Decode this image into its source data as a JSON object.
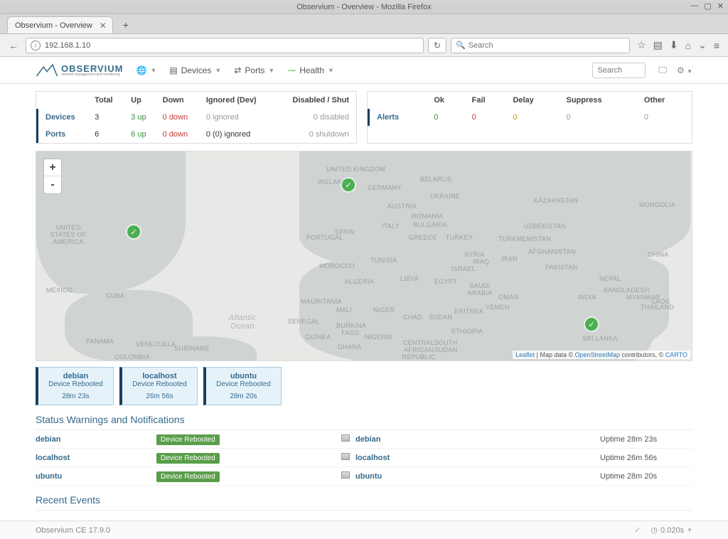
{
  "browser": {
    "window_title": "Observium - Overview - Mozilla Firefox",
    "tab_title": "Observium - Overview",
    "url": "192.168.1.10",
    "search_placeholder": "Search"
  },
  "nav": {
    "logo_main": "OBSERVIUM",
    "logo_sub": "network management and monitoring",
    "items": [
      {
        "label": "Devices"
      },
      {
        "label": "Ports"
      },
      {
        "label": "Health"
      }
    ],
    "search_placeholder": "Search"
  },
  "summary": {
    "headers": [
      "",
      "Total",
      "Up",
      "Down",
      "Ignored (Dev)",
      "Disabled / Shut"
    ],
    "rows": [
      {
        "label": "Devices",
        "total": "3",
        "up": "3 up",
        "down": "0 down",
        "ignored": "0 ignored",
        "disabled": "0 disabled"
      },
      {
        "label": "Ports",
        "total": "6",
        "up": "6 up",
        "down": "0 down",
        "ignored": "0 (0) ignored",
        "disabled": "0 shutdown"
      }
    ]
  },
  "alerts": {
    "headers": [
      "",
      "Ok",
      "Fail",
      "Delay",
      "Suppress",
      "Other"
    ],
    "row": {
      "label": "Alerts",
      "ok": "0",
      "fail": "0",
      "delay": "0",
      "suppress": "0",
      "other": "0"
    }
  },
  "map": {
    "zoom_in": "+",
    "zoom_out": "-",
    "labels": [
      "UNITED KINGDOM",
      "IRELAND",
      "GERMANY",
      "BELARUS",
      "UKRAINE",
      "AUSTRIA",
      "ROMANIA",
      "BULGARIA",
      "ITALY",
      "SPAIN",
      "PORTUGAL",
      "GREECE",
      "TURKEY",
      "KAZAKHSTAN",
      "UZBEKISTAN",
      "TURKMENISTAN",
      "MONGOLIA",
      "CHINA",
      "UNITED STATES OF AMERICA",
      "MEXICO",
      "CUBA",
      "PANAMA",
      "VENEZUELA",
      "COLOMBIA",
      "SURINAME",
      "MOROCCO",
      "ALGERIA",
      "TUNISIA",
      "LIBYA",
      "EGYPT",
      "SYRIA",
      "IRAQ",
      "IRAN",
      "ISRAEL",
      "SAUDI ARABIA",
      "YEMEN",
      "OMAN",
      "PAKISTAN",
      "AFGHANISTAN",
      "INDIA",
      "NEPAL",
      "BANGLADESH",
      "MYANMAR",
      "THAILAND",
      "LAOS",
      "SRI LANKA",
      "MAURITANIA",
      "SENEGAL",
      "GUINEA",
      "MALI",
      "BURKINA FASO",
      "NIGER",
      "NIGERIA",
      "CHAD",
      "SUDAN",
      "ERITREA",
      "ETHIOPIA",
      "CENTRAL AFRICAN REPUBLIC",
      "SOUTH SUDAN",
      "GHANA",
      "Atlantic Ocean"
    ],
    "attribution": {
      "leaflet": "Leaflet",
      "sep": " | Map data © ",
      "osm": "OpenStreetMap",
      "tail": " contributors, © ",
      "carto": "CARTO"
    }
  },
  "reboot_cards": [
    {
      "name": "debian",
      "msg": "Device Rebooted",
      "time": "28m 23s"
    },
    {
      "name": "localhost",
      "msg": "Device Rebooted",
      "time": "26m 56s"
    },
    {
      "name": "ubuntu",
      "msg": "Device Rebooted",
      "time": "28m 20s"
    }
  ],
  "sections": {
    "status_header": "Status Warnings and Notifications",
    "recent_events": "Recent Events"
  },
  "status_rows": [
    {
      "name": "debian",
      "badge": "Device Rebooted",
      "device": "debian",
      "uptime": "Uptime 28m 23s"
    },
    {
      "name": "localhost",
      "badge": "Device Rebooted",
      "device": "localhost",
      "uptime": "Uptime 26m 56s"
    },
    {
      "name": "ubuntu",
      "badge": "Device Rebooted",
      "device": "ubuntu",
      "uptime": "Uptime 28m 20s"
    }
  ],
  "footer": {
    "version": "Observium CE 17.9.0",
    "timing": "0.020s"
  }
}
